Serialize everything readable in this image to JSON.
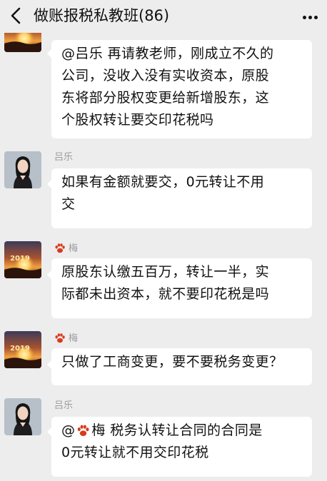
{
  "header": {
    "title": "做账报税私教班(86)",
    "back_icon": "chevron-left-icon",
    "more_icon": "more-dots-icon"
  },
  "messages": [
    {
      "sender": "",
      "avatar": "sunset-2019-avatar",
      "lines": [
        "@吕乐  再请教老师，刚成立不久的",
        "公司，没收入没有实收资本，原股",
        "东将部分股权变更给新增股东，这",
        "个股权转让要交印花税吗"
      ]
    },
    {
      "sender": "吕乐",
      "avatar": "woman-portrait-avatar",
      "lines": [
        "如果有金额就要交，0元转让不用",
        "交"
      ]
    },
    {
      "sender": "梅",
      "avatar": "sunset-2019-avatar",
      "lines": [
        "原股东认缴五百万，转让一半，实",
        "际都未出资本，就不要印花税是吗"
      ]
    },
    {
      "sender": "梅",
      "avatar": "sunset-2019-avatar",
      "lines": [
        "只做了工商变更，要不要税务变更？"
      ]
    },
    {
      "sender": "吕乐",
      "avatar": "woman-portrait-avatar",
      "mention": "@",
      "line1_rest": "梅  税务认转让合同的合同是",
      "lines": [
        "0元转让就不用交印花税"
      ]
    }
  ],
  "paw_icon": "paw-icon",
  "avatar_text": "2019",
  "colors": {
    "background": "#ededed",
    "bubble": "#ffffff",
    "sender_name": "#9a9a9a",
    "paw": "#d93a1c"
  }
}
